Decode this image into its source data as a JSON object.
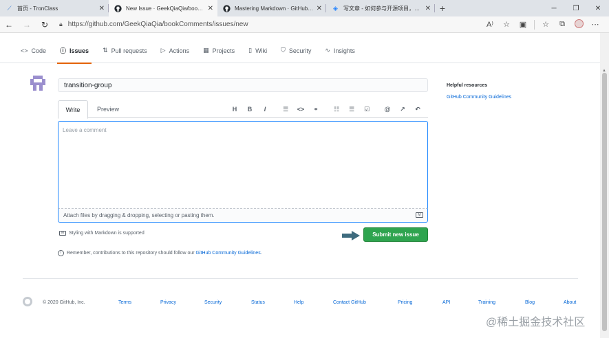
{
  "browser": {
    "tabs": [
      {
        "title": "首页 - TronClass",
        "close": "✕"
      },
      {
        "title": "New Issue · GeekQiaQia/bookCo",
        "close": "✕"
      },
      {
        "title": "Mastering Markdown · GitHub G",
        "close": "✕"
      },
      {
        "title": "写文章 - 如何参与开源项目，并用",
        "close": "✕"
      }
    ],
    "new_tab": "+",
    "url": "https://github.com/GeekQiaQia/bookComments/issues/new"
  },
  "repo_nav": [
    {
      "label": "Code",
      "icon": "<>"
    },
    {
      "label": "Issues",
      "icon": "ⓘ"
    },
    {
      "label": "Pull requests",
      "icon": "⇅"
    },
    {
      "label": "Actions",
      "icon": "▷"
    },
    {
      "label": "Projects",
      "icon": "▦"
    },
    {
      "label": "Wiki",
      "icon": "▯"
    },
    {
      "label": "Security",
      "icon": "⛉"
    },
    {
      "label": "Insights",
      "icon": "∿"
    }
  ],
  "issue": {
    "title_value": "transition-group",
    "tab_write": "Write",
    "tab_preview": "Preview",
    "comment_placeholder": "Leave a comment",
    "attach_text": "Attach files by dragging & dropping, selecting or pasting them.",
    "markdown_note": "Styling with Markdown is supported",
    "submit_label": "Submit new issue"
  },
  "toolbar": {
    "heading": "H",
    "bold": "B",
    "italic": "I",
    "quote": "☰",
    "code": "<>",
    "link": "⚭",
    "ul": "☷",
    "ol": "☰",
    "task": "☑",
    "mention": "@",
    "reference": "↗",
    "reply": "↶"
  },
  "contrib": {
    "text": "Remember, contributions to this repository should follow our",
    "link": "GitHub Community Guidelines",
    "end": "."
  },
  "sidebar": {
    "heading": "Helpful resources",
    "link": "GitHub Community Guidelines"
  },
  "footer": {
    "copyright": "© 2020 GitHub, Inc.",
    "links": [
      "Terms",
      "Privacy",
      "Security",
      "Status",
      "Help",
      "Contact GitHub",
      "Pricing",
      "API",
      "Training",
      "Blog",
      "About"
    ]
  },
  "watermark": "@稀土掘金技术社区",
  "colors": {
    "accent": "#2ea44f",
    "link": "#0366d6",
    "focus": "#2188ff",
    "tab_underline": "#e36209"
  }
}
